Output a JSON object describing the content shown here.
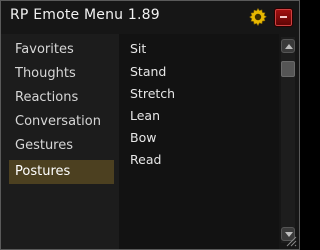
{
  "window": {
    "title": "RP Emote Menu 1.89"
  },
  "colors": {
    "background": "#161616",
    "sidebar": "#1c1c1c",
    "selected": "#4c4020",
    "accent_gold": "#e8b800",
    "close_red": "#a51010"
  },
  "icons": {
    "settings": "gear-icon",
    "close": "close-icon",
    "scroll_up": "chevron-up-icon",
    "scroll_down": "chevron-down-icon",
    "resize": "resize-grip-icon"
  },
  "sidebar": {
    "selected": "Postures",
    "items": [
      {
        "label": "Favorites"
      },
      {
        "label": "Thoughts"
      },
      {
        "label": "Reactions"
      },
      {
        "label": "Conversation"
      },
      {
        "label": "Gestures"
      },
      {
        "label": "Postures"
      }
    ]
  },
  "emotes": [
    {
      "label": "Sit"
    },
    {
      "label": "Stand"
    },
    {
      "label": "Stretch"
    },
    {
      "label": "Lean"
    },
    {
      "label": "Bow"
    },
    {
      "label": "Read"
    }
  ]
}
